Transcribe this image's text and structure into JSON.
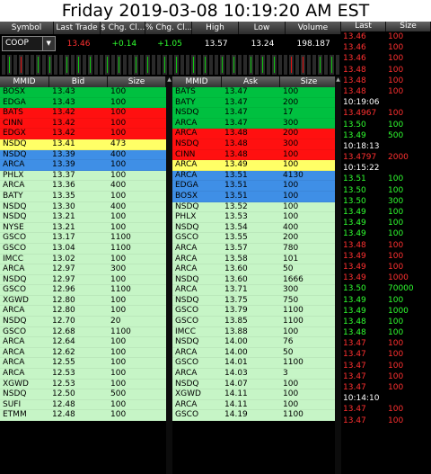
{
  "window": {
    "title": "Friday 2019-03-08 10:19:20 AM EST"
  },
  "quote": {
    "headers": [
      "Symbol",
      "Last Trade",
      "$ Chg. Cl...",
      "% Chg. Cl...",
      "High",
      "Low",
      "Volume"
    ],
    "symbol": "COOP",
    "last": "13.46",
    "chg": "+0.14",
    "pct": "+1.05",
    "high": "13.57",
    "low": "13.24",
    "volume": "198.187",
    "colors": {
      "last": "#ff3030",
      "chg": "#30ff30",
      "pct": "#30ff30",
      "neutral": "#ffffff"
    }
  },
  "activity_bars": [
    "green",
    "green",
    "green",
    "red",
    "green",
    "green",
    "green",
    "green",
    "green",
    "green",
    "green",
    "green",
    "green",
    "green",
    "red",
    "green",
    "green",
    "red",
    "green",
    "green",
    "green",
    "red",
    "red",
    "green",
    "green",
    "green",
    "green",
    "red",
    "green",
    "red",
    "green",
    "green",
    "green",
    "green",
    "red",
    "green",
    "red",
    "red",
    "green",
    "green",
    "green",
    "green",
    "red",
    "green",
    "green",
    "green",
    "red",
    "green",
    "red",
    "green",
    "red",
    "green",
    "red",
    "red",
    "green",
    "green",
    "green",
    "green",
    "green"
  ],
  "bid": {
    "headers": [
      "MMID",
      "Bid",
      "Size"
    ],
    "rows": [
      [
        "BOSX",
        "13.43",
        "100",
        "#00c040"
      ],
      [
        "EDGA",
        "13.43",
        "100",
        "#00c040"
      ],
      [
        "BATS",
        "13.42",
        "100",
        "#ff1010"
      ],
      [
        "CINN",
        "13.42",
        "100",
        "#ff1010"
      ],
      [
        "EDGX",
        "13.42",
        "100",
        "#ff1010"
      ],
      [
        "NSDQ",
        "13.41",
        "473",
        "#ffff66"
      ],
      [
        "NSDQ",
        "13.39",
        "400",
        "#3f8fe6"
      ],
      [
        "ARCA",
        "13.39",
        "100",
        "#3f8fe6"
      ],
      [
        "PHLX",
        "13.37",
        "100",
        "#c6f5c6"
      ],
      [
        "ARCA",
        "13.36",
        "400",
        "#c6f5c6"
      ],
      [
        "BATY",
        "13.35",
        "100",
        "#c6f5c6"
      ],
      [
        "NSDQ",
        "13.30",
        "400",
        "#c6f5c6"
      ],
      [
        "NSDQ",
        "13.21",
        "100",
        "#c6f5c6"
      ],
      [
        "NYSE",
        "13.21",
        "100",
        "#c6f5c6"
      ],
      [
        "GSCO",
        "13.17",
        "1100",
        "#c6f5c6"
      ],
      [
        "GSCO",
        "13.04",
        "1100",
        "#c6f5c6"
      ],
      [
        "IMCC",
        "13.02",
        "100",
        "#c6f5c6"
      ],
      [
        "ARCA",
        "12.97",
        "300",
        "#c6f5c6"
      ],
      [
        "NSDQ",
        "12.97",
        "100",
        "#c6f5c6"
      ],
      [
        "GSCO",
        "12.96",
        "1100",
        "#c6f5c6"
      ],
      [
        "XGWD",
        "12.80",
        "100",
        "#c6f5c6"
      ],
      [
        "ARCA",
        "12.80",
        "100",
        "#c6f5c6"
      ],
      [
        "NSDQ",
        "12.70",
        "20",
        "#c6f5c6"
      ],
      [
        "GSCO",
        "12.68",
        "1100",
        "#c6f5c6"
      ],
      [
        "ARCA",
        "12.64",
        "100",
        "#c6f5c6"
      ],
      [
        "ARCA",
        "12.62",
        "100",
        "#c6f5c6"
      ],
      [
        "ARCA",
        "12.55",
        "100",
        "#c6f5c6"
      ],
      [
        "ARCA",
        "12.53",
        "100",
        "#c6f5c6"
      ],
      [
        "XGWD",
        "12.53",
        "100",
        "#c6f5c6"
      ],
      [
        "NSDQ",
        "12.50",
        "500",
        "#c6f5c6"
      ],
      [
        "SUFI",
        "12.48",
        "100",
        "#c6f5c6"
      ],
      [
        "ETMM",
        "12.48",
        "100",
        "#c6f5c6"
      ]
    ]
  },
  "ask": {
    "headers": [
      "MMID",
      "Ask",
      "Size"
    ],
    "rows": [
      [
        "BATS",
        "13.47",
        "100",
        "#00c040"
      ],
      [
        "BATY",
        "13.47",
        "200",
        "#00c040"
      ],
      [
        "NSDQ",
        "13.47",
        "17",
        "#00c040"
      ],
      [
        "ARCA",
        "13.47",
        "300",
        "#00c040"
      ],
      [
        "ARCA",
        "13.48",
        "200",
        "#ff1010"
      ],
      [
        "NSDQ",
        "13.48",
        "300",
        "#ff1010"
      ],
      [
        "CINN",
        "13.48",
        "100",
        "#ff1010"
      ],
      [
        "ARCA",
        "13.49",
        "100",
        "#ffff66"
      ],
      [
        "ARCA",
        "13.51",
        "4130",
        "#3f8fe6"
      ],
      [
        "EDGA",
        "13.51",
        "100",
        "#3f8fe6"
      ],
      [
        "BOSX",
        "13.51",
        "100",
        "#3f8fe6"
      ],
      [
        "NSDQ",
        "13.52",
        "100",
        "#c6f5c6"
      ],
      [
        "PHLX",
        "13.53",
        "100",
        "#c6f5c6"
      ],
      [
        "NSDQ",
        "13.54",
        "400",
        "#c6f5c6"
      ],
      [
        "GSCO",
        "13.55",
        "200",
        "#c6f5c6"
      ],
      [
        "ARCA",
        "13.57",
        "780",
        "#c6f5c6"
      ],
      [
        "ARCA",
        "13.58",
        "101",
        "#c6f5c6"
      ],
      [
        "ARCA",
        "13.60",
        "50",
        "#c6f5c6"
      ],
      [
        "NSDQ",
        "13.60",
        "1666",
        "#c6f5c6"
      ],
      [
        "ARCA",
        "13.71",
        "300",
        "#c6f5c6"
      ],
      [
        "NSDQ",
        "13.75",
        "750",
        "#c6f5c6"
      ],
      [
        "GSCO",
        "13.79",
        "1100",
        "#c6f5c6"
      ],
      [
        "GSCO",
        "13.85",
        "1100",
        "#c6f5c6"
      ],
      [
        "IMCC",
        "13.88",
        "100",
        "#c6f5c6"
      ],
      [
        "NSDQ",
        "14.00",
        "76",
        "#c6f5c6"
      ],
      [
        "ARCA",
        "14.00",
        "50",
        "#c6f5c6"
      ],
      [
        "GSCO",
        "14.01",
        "1100",
        "#c6f5c6"
      ],
      [
        "ARCA",
        "14.03",
        "3",
        "#c6f5c6"
      ],
      [
        "NSDQ",
        "14.07",
        "100",
        "#c6f5c6"
      ],
      [
        "XGWD",
        "14.11",
        "100",
        "#c6f5c6"
      ],
      [
        "ARCA",
        "14.11",
        "100",
        "#c6f5c6"
      ],
      [
        "GSCO",
        "14.19",
        "1100",
        "#c6f5c6"
      ]
    ]
  },
  "tape": {
    "headers": [
      "Last",
      "Size"
    ],
    "rows": [
      [
        "13.46",
        "100",
        "#ff3030"
      ],
      [
        "13.46",
        "100",
        "#ff3030"
      ],
      [
        "13.46",
        "100",
        "#ff3030"
      ],
      [
        "13.48",
        "100",
        "#ff3030"
      ],
      [
        "13.48",
        "100",
        "#ff3030"
      ],
      [
        "13.48",
        "100",
        "#ff3030"
      ],
      [
        "10:19:06",
        "",
        "#ffffff"
      ],
      [
        "13.4967",
        "100",
        "#ff3030"
      ],
      [
        "13.50",
        "100",
        "#30ff30"
      ],
      [
        "13.49",
        "500",
        "#30ff30"
      ],
      [
        "10:18:13",
        "",
        "#ffffff"
      ],
      [
        "13.4797",
        "2000",
        "#ff3030"
      ],
      [
        "10:15:22",
        "",
        "#ffffff"
      ],
      [
        "13.51",
        "100",
        "#30ff30"
      ],
      [
        "13.50",
        "100",
        "#30ff30"
      ],
      [
        "13.50",
        "300",
        "#30ff30"
      ],
      [
        "13.49",
        "100",
        "#30ff30"
      ],
      [
        "13.49",
        "100",
        "#30ff30"
      ],
      [
        "13.49",
        "100",
        "#30ff30"
      ],
      [
        "13.48",
        "100",
        "#ff3030"
      ],
      [
        "13.49",
        "100",
        "#ff3030"
      ],
      [
        "13.49",
        "100",
        "#ff3030"
      ],
      [
        "13.49",
        "1000",
        "#ff3030"
      ],
      [
        "13.50",
        "70000",
        "#30ff30"
      ],
      [
        "13.49",
        "100",
        "#30ff30"
      ],
      [
        "13.49",
        "1000",
        "#30ff30"
      ],
      [
        "13.48",
        "100",
        "#30ff30"
      ],
      [
        "13.48",
        "100",
        "#30ff30"
      ],
      [
        "13.47",
        "100",
        "#ff3030"
      ],
      [
        "13.47",
        "100",
        "#ff3030"
      ],
      [
        "13.47",
        "100",
        "#ff3030"
      ],
      [
        "13.47",
        "100",
        "#ff3030"
      ],
      [
        "13.47",
        "100",
        "#ff3030"
      ],
      [
        "10:14:10",
        "",
        "#ffffff"
      ],
      [
        "13.47",
        "100",
        "#ff3030"
      ],
      [
        "13.47",
        "100",
        "#ff3030"
      ]
    ]
  }
}
